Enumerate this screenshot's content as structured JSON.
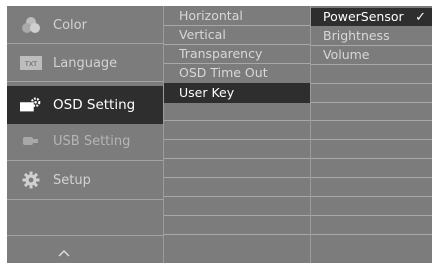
{
  "main_menu": {
    "items": [
      {
        "label": "Color",
        "icon": "color-icon"
      },
      {
        "label": "Language",
        "icon": "language-icon",
        "icon_text": "TXT"
      },
      {
        "label": "OSD Setting",
        "icon": "osd-setting-icon"
      },
      {
        "label": "USB Setting",
        "icon": "usb-icon"
      },
      {
        "label": "Setup",
        "icon": "gear-icon"
      }
    ],
    "active_index": 2,
    "scroll_icon": "chevron-up-icon"
  },
  "osd_options": {
    "items": [
      "Horizontal",
      "Vertical",
      "Transparency",
      "OSD Time Out",
      "User Key"
    ],
    "active_index": 4
  },
  "user_key_options": {
    "items": [
      "PowerSensor",
      "Brightness",
      "Volume"
    ],
    "selected_index": 0,
    "check_mark": "✓"
  },
  "colors": {
    "panel": "#7c7c7c",
    "highlight": "#2e2e2e",
    "text": "#d8d8d8",
    "active_text": "#ffffff"
  }
}
